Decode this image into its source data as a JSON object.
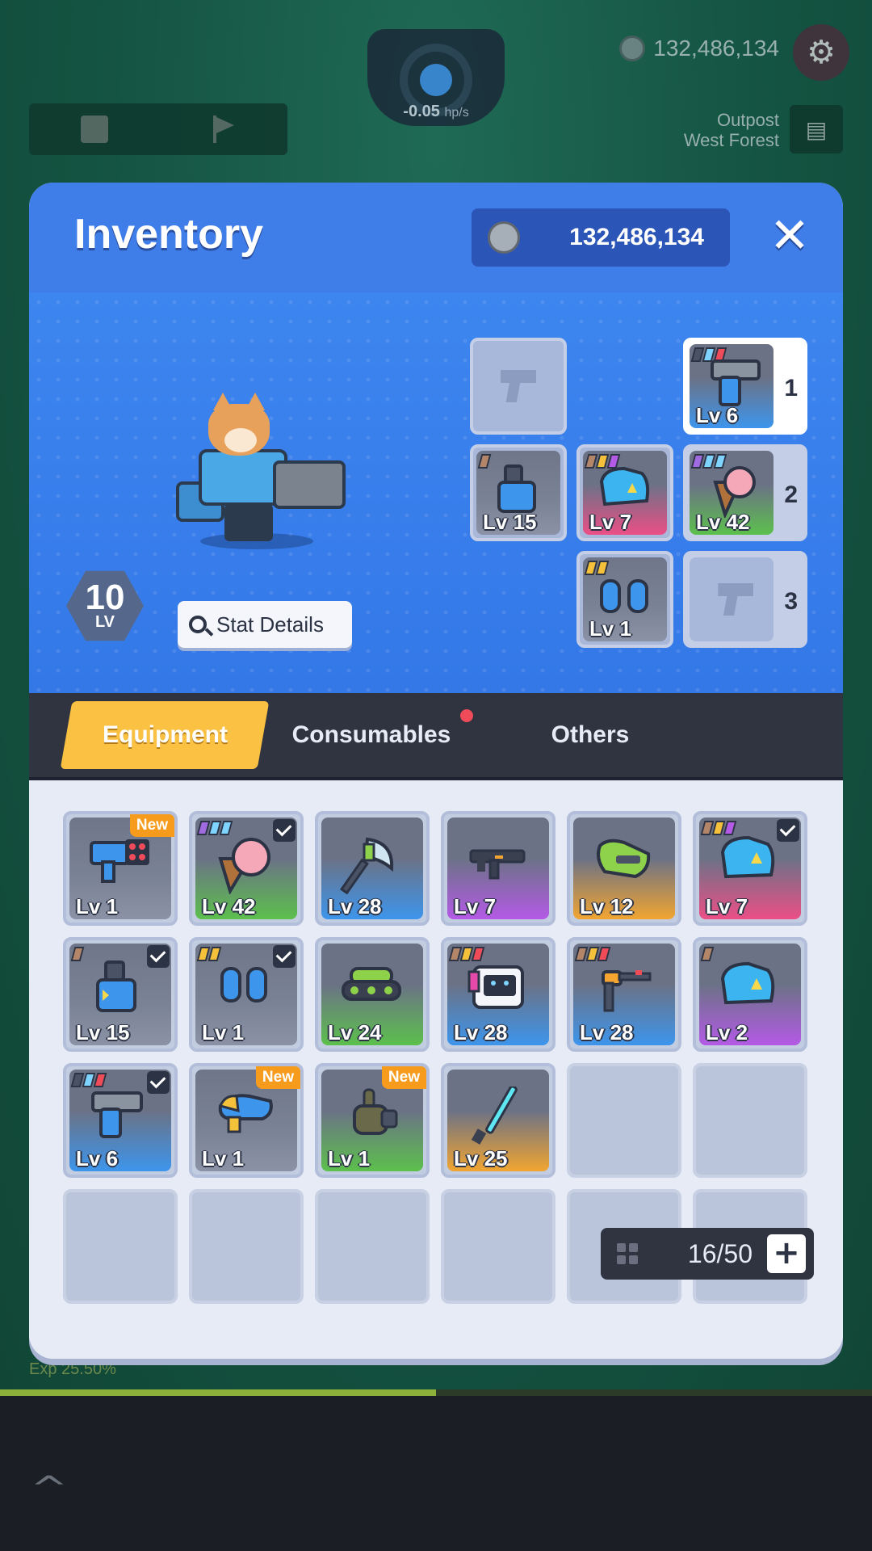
{
  "hud": {
    "hp_rate": "-0.05",
    "hp_unit": "hp/s",
    "coins": "132,486,134",
    "location_line1": "Outpost",
    "location_line2": "West Forest",
    "exp_label": "Exp 25.50%",
    "exp_progress": 0.5
  },
  "inventory": {
    "title": "Inventory",
    "coins": "132,486,134",
    "player_level": "10",
    "level_label": "LV",
    "stat_button": "Stat Details",
    "equipped": {
      "top_empty": {
        "type": "empty"
      },
      "slot1": {
        "level": "Lv 6",
        "number": "1",
        "color": "blue",
        "rarity": [
          "#4a5366",
          "#7fd3ff",
          "#ef4b58"
        ]
      },
      "row2": [
        {
          "level": "Lv 15",
          "color": "gray",
          "rarity": [
            "#b3866a"
          ]
        },
        {
          "level": "Lv 7",
          "color": "pink",
          "rarity": [
            "#b3866a",
            "#f6c13a",
            "#b45ae6"
          ]
        },
        {
          "level": "Lv 42",
          "color": "green",
          "rarity": [
            "#a06ae0",
            "#7fd3ff",
            "#7fd3ff"
          ]
        }
      ],
      "slot2_number": "2",
      "row3": [
        {
          "level": "Lv 1",
          "color": "gray",
          "rarity": [
            "#f6c13a",
            "#f6c13a"
          ]
        }
      ],
      "slot3_number": "3"
    },
    "tabs": {
      "equipment": "Equipment",
      "consumables": "Consumables",
      "others": "Others"
    },
    "items": [
      {
        "level": "Lv 1",
        "color": "gray",
        "badge": "New",
        "icon": "rocket-launcher-icon",
        "rarity": []
      },
      {
        "level": "Lv 42",
        "color": "green",
        "badge": "check",
        "icon": "ice-cream-cone-icon",
        "rarity": [
          "#a06ae0",
          "#7fd3ff",
          "#7fd3ff"
        ]
      },
      {
        "level": "Lv 28",
        "color": "blue",
        "badge": "",
        "icon": "axe-icon",
        "rarity": []
      },
      {
        "level": "Lv 7",
        "color": "purple",
        "badge": "",
        "icon": "assault-rifle-icon",
        "rarity": []
      },
      {
        "level": "Lv 12",
        "color": "orange",
        "badge": "",
        "icon": "green-armor-icon",
        "rarity": []
      },
      {
        "level": "Lv 7",
        "color": "pink",
        "badge": "check",
        "icon": "blue-helmet-icon",
        "rarity": [
          "#b3866a",
          "#f6c13a",
          "#b45ae6"
        ]
      },
      {
        "level": "Lv 15",
        "color": "gray",
        "badge": "check",
        "icon": "jetpack-icon",
        "rarity": [
          "#b3866a"
        ]
      },
      {
        "level": "Lv 1",
        "color": "gray",
        "badge": "check",
        "icon": "boots-icon",
        "rarity": [
          "#f6c13a",
          "#f6c13a"
        ]
      },
      {
        "level": "Lv 24",
        "color": "green",
        "badge": "",
        "icon": "tank-icon",
        "rarity": []
      },
      {
        "level": "Lv 28",
        "color": "blue",
        "badge": "",
        "icon": "robot-head-icon",
        "rarity": [
          "#b3866a",
          "#f6c13a",
          "#ef4b58"
        ]
      },
      {
        "level": "Lv 28",
        "color": "blue",
        "badge": "",
        "icon": "turret-gun-icon",
        "rarity": [
          "#b3866a",
          "#f6c13a",
          "#ef4b58"
        ]
      },
      {
        "level": "Lv 2",
        "color": "purple",
        "badge": "",
        "icon": "blue-helmet-icon",
        "rarity": [
          "#b3866a"
        ]
      },
      {
        "level": "Lv 6",
        "color": "blue",
        "badge": "check",
        "icon": "pistol-icon",
        "rarity": [
          "#4a5366",
          "#7fd3ff",
          "#ef4b58"
        ]
      },
      {
        "level": "Lv 1",
        "color": "gray",
        "badge": "New",
        "icon": "raygun-icon",
        "rarity": []
      },
      {
        "level": "Lv 1",
        "color": "green",
        "badge": "New",
        "icon": "gauntlet-icon",
        "rarity": []
      },
      {
        "level": "Lv 25",
        "color": "orange",
        "badge": "",
        "icon": "laser-sword-icon",
        "rarity": []
      }
    ],
    "empty_slots": 8,
    "capacity": "16/50",
    "colors": {
      "header_blue": "#3f7de8",
      "tab_active": "#fbc143",
      "badge_new": "#f69b1c",
      "notification": "#ef4b58"
    }
  }
}
